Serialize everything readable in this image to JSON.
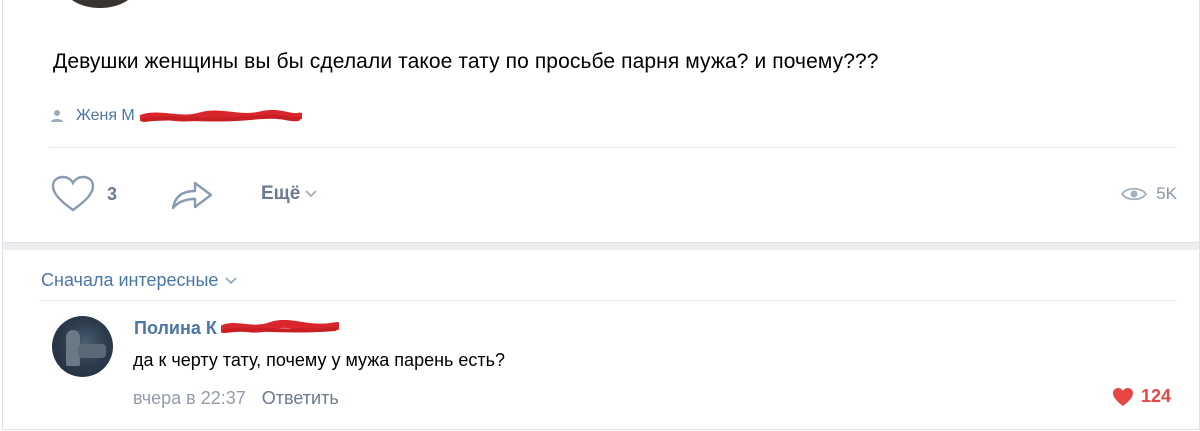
{
  "post": {
    "text": "Девушки женщины вы бы сделали такое тату по просьбе парня мужа? и почему???",
    "author": "Женя М",
    "likes": "3",
    "more_label": "Ещё",
    "views": "5K"
  },
  "comments": {
    "sort_label": "Сначала интересные",
    "items": [
      {
        "name": "Полина К",
        "text": "да к черту тату, почему у мужа парень есть?",
        "time": "вчера в 22:37",
        "reply_label": "Ответить",
        "likes": "124"
      }
    ]
  },
  "colors": {
    "link": "#4a76a8",
    "muted": "#6b7a8f",
    "like_active": "#e64646",
    "redaction": "#d8262c"
  },
  "icons": [
    "person-icon",
    "heart-outline-icon",
    "share-arrow-icon",
    "chevron-down-icon",
    "eye-icon",
    "heart-filled-icon"
  ]
}
